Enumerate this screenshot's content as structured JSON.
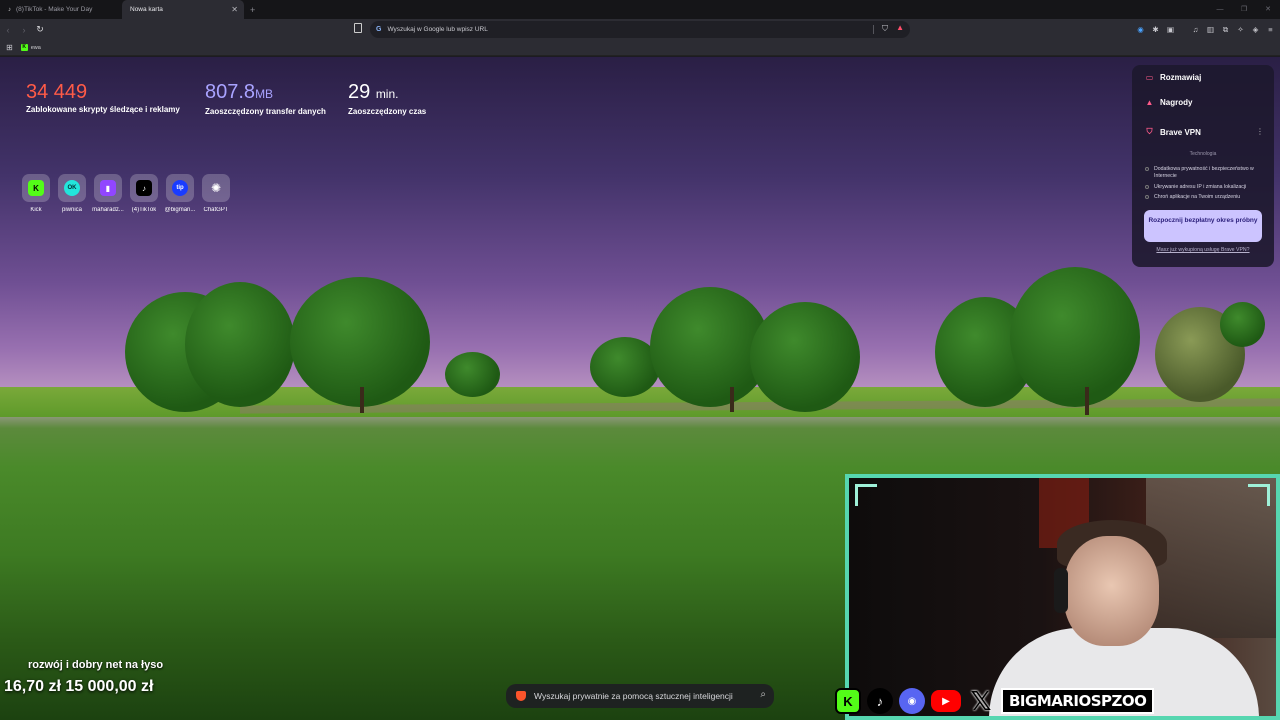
{
  "tabs": [
    {
      "title": "(8)TikTok - Make Your Day",
      "active": false
    },
    {
      "title": "Nowa karta",
      "active": true
    }
  ],
  "tab_close": "✕",
  "new_tab_symbol": "+",
  "address_bar": {
    "placeholder": "Wyszukaj w Google lub wpisz URL"
  },
  "bookmarks": [
    {
      "label": "ewa",
      "icon": "kick-icon"
    }
  ],
  "stats": {
    "blocked_value": "34 449",
    "blocked_label": "Zablokowane skrypty śledzące i reklamy",
    "saved_bw_value": "807.8",
    "saved_bw_unit": "MB",
    "saved_bw_label": "Zaoszczędzony transfer danych",
    "saved_time_value": "29",
    "saved_time_unit": "min.",
    "saved_time_label": "Zaoszczędzony czas"
  },
  "top_sites": [
    {
      "name": "Kick",
      "glyph": "K",
      "bg": "#53fc18",
      "fg": "#000000"
    },
    {
      "name": "piwnica",
      "glyph": "OK",
      "bg": "#23e5db",
      "fg": "#002f34"
    },
    {
      "name": "maharadz...",
      "glyph": "▮",
      "bg": "#9146ff",
      "fg": "#ffffff"
    },
    {
      "name": "(4)TikTok",
      "glyph": "♪",
      "bg": "#000000",
      "fg": "#ffffff"
    },
    {
      "name": "@bigmari...",
      "glyph": "tip",
      "bg": "#1a3cff",
      "fg": "#ffffff"
    },
    {
      "name": "ChatGPT",
      "glyph": "✺",
      "bg": "transparent",
      "fg": "#ffffff"
    }
  ],
  "panel": {
    "chat": "Rozmawiaj",
    "rewards": "Nagrody",
    "vpn": "Brave VPN",
    "tech": "Technologia",
    "features": [
      "Dodatkowa prywatność i bezpieczeństwo w Internecie",
      "Ukrywanie adresu IP i zmiana lokalizacji",
      "Chroń aplikacje na Twoim urządzeniu"
    ],
    "cta": "Rozpocznij bezpłatny okres próbny",
    "link": "Masz już wykupioną usługę Brave VPN?"
  },
  "stream": {
    "promo": "rozwój i dobry net na łyso",
    "price_current": "16,70 zł",
    "price_goal": "15 000,00 zł",
    "handle": "BIGMARIOSPZOO"
  },
  "ai_search": {
    "placeholder": "Wyszukaj prywatnie za pomocą sztucznej inteligencji"
  },
  "colors": {
    "accent_red": "#ff5b47",
    "accent_purple": "#a9a3ff",
    "webcam_border": "#56d6b0"
  }
}
